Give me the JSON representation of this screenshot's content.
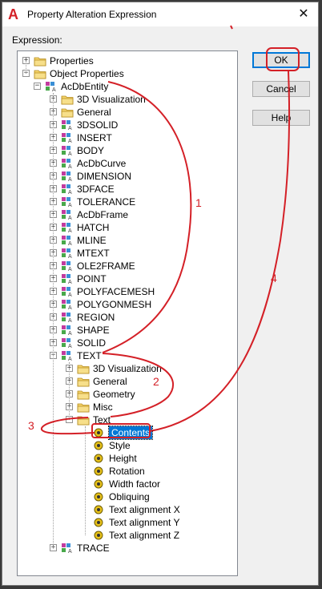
{
  "window": {
    "title": "Property Alteration Expression",
    "close_glyph": "✕",
    "app_icon_glyph": "A"
  },
  "expression_label": "Expression:",
  "buttons": {
    "ok": "OK",
    "cancel": "Cancel",
    "help": "Help"
  },
  "tree": {
    "properties": "Properties",
    "object_properties": "Object Properties",
    "acdbentity": "AcDbEntity",
    "entity_children": [
      "3D Visualization",
      "General",
      "3DSOLID",
      "INSERT",
      "BODY",
      "AcDbCurve",
      "DIMENSION",
      "3DFACE",
      "TOLERANCE",
      "AcDbFrame",
      "HATCH",
      "MLINE",
      "MTEXT",
      "OLE2FRAME",
      "POINT",
      "POLYFACEMESH",
      "POLYGONMESH",
      "REGION",
      "SHAPE",
      "SOLID",
      "TEXT"
    ],
    "text_children": [
      "3D Visualization",
      "General",
      "Geometry",
      "Misc",
      "Text"
    ],
    "text_props": [
      "Contents",
      "Style",
      "Height",
      "Rotation",
      "Width factor",
      "Obliquing",
      "Text alignment X",
      "Text alignment Y",
      "Text alignment Z"
    ],
    "trace": "TRACE",
    "selected": "Contents"
  },
  "annotations": {
    "step1": "1",
    "step2": "2",
    "step3": "3",
    "step4": "4",
    "color": "#d42027"
  }
}
